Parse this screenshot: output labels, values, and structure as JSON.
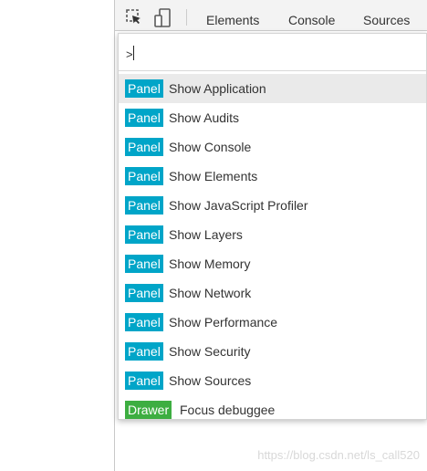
{
  "toolbar": {
    "inspect_icon": "inspect-element-icon",
    "device_icon": "device-toolbar-icon",
    "tabs": [
      {
        "label": "Elements"
      },
      {
        "label": "Console"
      },
      {
        "label": "Sources"
      }
    ]
  },
  "command_menu": {
    "prompt": ">",
    "items": [
      {
        "badge": "Panel",
        "badge_type": "panel",
        "label": "Show Application",
        "selected": true
      },
      {
        "badge": "Panel",
        "badge_type": "panel",
        "label": "Show Audits"
      },
      {
        "badge": "Panel",
        "badge_type": "panel",
        "label": "Show Console"
      },
      {
        "badge": "Panel",
        "badge_type": "panel",
        "label": "Show Elements"
      },
      {
        "badge": "Panel",
        "badge_type": "panel",
        "label": "Show JavaScript Profiler"
      },
      {
        "badge": "Panel",
        "badge_type": "panel",
        "label": "Show Layers"
      },
      {
        "badge": "Panel",
        "badge_type": "panel",
        "label": "Show Memory"
      },
      {
        "badge": "Panel",
        "badge_type": "panel",
        "label": "Show Network"
      },
      {
        "badge": "Panel",
        "badge_type": "panel",
        "label": "Show Performance"
      },
      {
        "badge": "Panel",
        "badge_type": "panel",
        "label": "Show Security"
      },
      {
        "badge": "Panel",
        "badge_type": "panel",
        "label": "Show Sources"
      },
      {
        "badge": "Drawer",
        "badge_type": "drawer",
        "label": "Focus debuggee"
      }
    ]
  },
  "colors": {
    "panel_badge": "#00a5c8",
    "drawer_badge": "#3dae41",
    "selected_row": "#eaeaea"
  },
  "watermark": "https://blog.csdn.net/ls_call520"
}
